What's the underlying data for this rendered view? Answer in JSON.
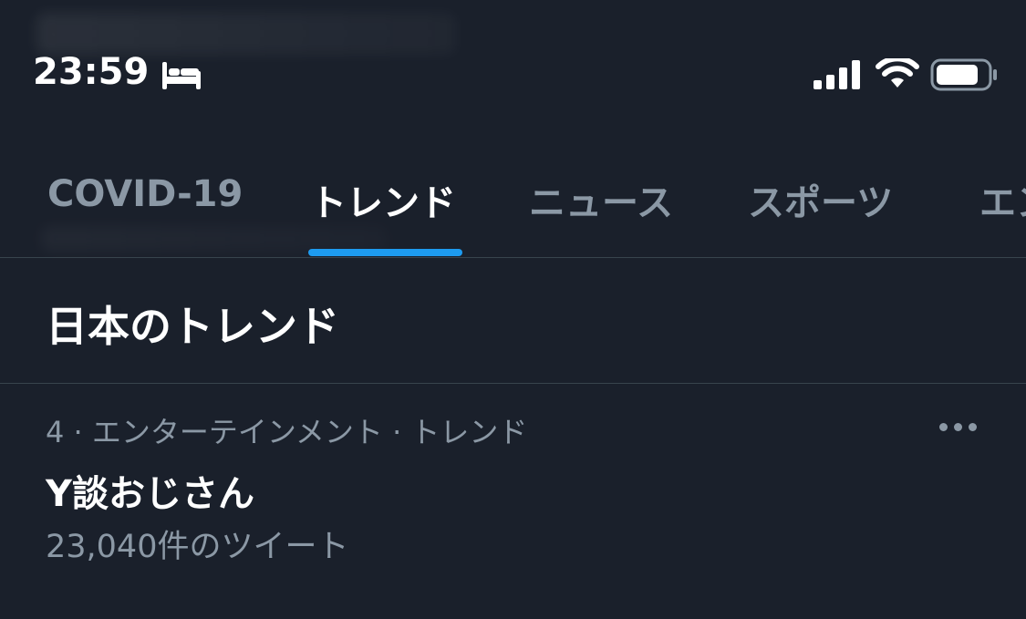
{
  "status_bar": {
    "time": "23:59",
    "focus_mode_icon": "bed-icon",
    "signal_icon": "cellular-signal-icon",
    "wifi_icon": "wifi-icon",
    "battery_icon": "battery-icon",
    "battery_level": 0.8
  },
  "tabs": [
    {
      "label": "COVID-19",
      "active": false
    },
    {
      "label": "トレンド",
      "active": true
    },
    {
      "label": "ニュース",
      "active": false
    },
    {
      "label": "スポーツ",
      "active": false
    },
    {
      "label": "エン",
      "active": false
    }
  ],
  "section": {
    "title": "日本のトレンド"
  },
  "trends": [
    {
      "meta": "4 · エンターテインメント · トレンド",
      "name": "Y談おじさん",
      "count": "23,040件のツイート",
      "more_icon": "more-horizontal-icon"
    }
  ],
  "colors": {
    "background": "#1a202b",
    "accent": "#1d9bf0",
    "secondary_text": "#8b98a5",
    "divider": "#38444d",
    "primary_text": "#ffffff"
  }
}
